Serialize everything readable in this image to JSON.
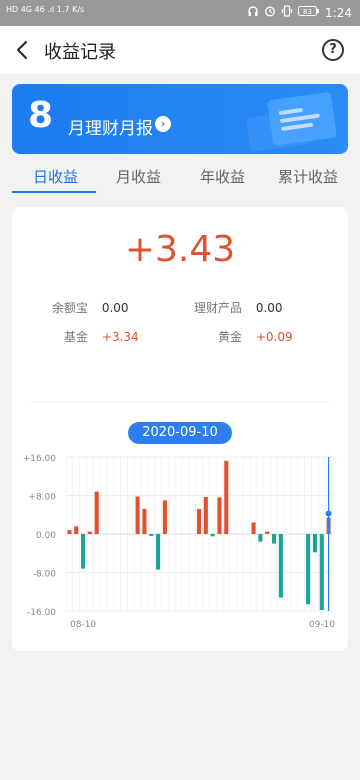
{
  "status_bar": {
    "left_text": "HD 4G 46 .ıl 1.7 K/s",
    "speed": "1.7",
    "speed_unit": "K/s",
    "battery": "83",
    "time": "1:24"
  },
  "header": {
    "title": "收益记录",
    "back_icon": "chevron-left-icon",
    "help_icon": "help-circle-icon",
    "help_label": "?"
  },
  "banner": {
    "month_number": "8",
    "text": "月理财月报",
    "arrow": "›",
    "bg_color": "#1c7cf0"
  },
  "tabs": [
    {
      "label": "日收益",
      "active": true
    },
    {
      "label": "月收益",
      "active": false
    },
    {
      "label": "年收益",
      "active": false
    },
    {
      "label": "累计收益",
      "active": false
    }
  ],
  "summary": {
    "total": "+3.43",
    "items": [
      {
        "label": "余额宝",
        "value": "0.00"
      },
      {
        "label": "理财产品",
        "value": "0.00"
      },
      {
        "label": "基金",
        "value": "+3.34"
      },
      {
        "label": "黄金",
        "value": "+0.09"
      }
    ]
  },
  "colors": {
    "positive": "#e0522f",
    "negative": "#1aa697",
    "accent": "#1a73e8"
  },
  "chart_data": {
    "type": "bar",
    "selected_date": "2020-09-10",
    "ylim": [
      -16,
      16
    ],
    "yticks": [
      "+16.00",
      "+8.00",
      "0.00",
      "-8.00",
      "-16.00"
    ],
    "ytick_values": [
      16,
      8,
      0,
      -8,
      -16
    ],
    "x_tick_labels": [
      "08-10",
      "09-10"
    ],
    "x_start": "08-10",
    "x_end": "09-10",
    "values": [
      0.8,
      1.6,
      -7.2,
      0.5,
      8.8,
      0,
      0,
      0,
      0,
      0,
      7.8,
      5.2,
      -0.4,
      -7.4,
      7.0,
      0,
      0,
      0,
      0,
      5.2,
      7.7,
      -0.5,
      7.6,
      15.2,
      0,
      0,
      0,
      2.4,
      -1.6,
      0.5,
      -2.0,
      -13.2,
      0,
      0,
      0,
      -14.6,
      -3.8,
      -15.8,
      3.43
    ]
  }
}
